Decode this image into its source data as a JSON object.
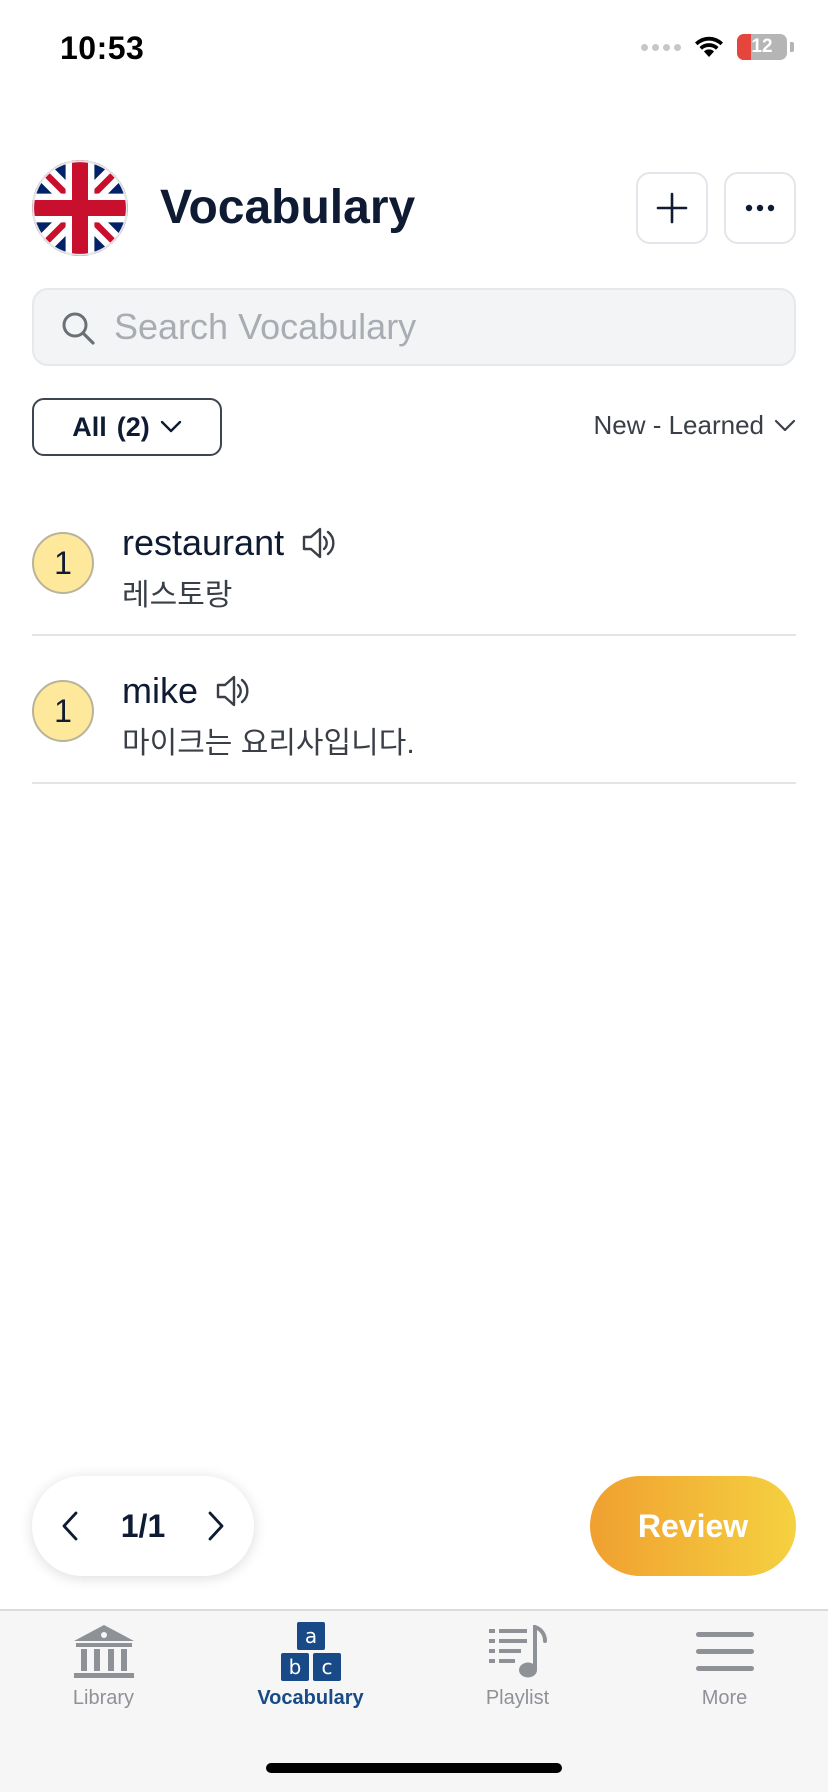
{
  "status_bar": {
    "time": "10:53",
    "battery_text": "12",
    "battery_level": 0.12,
    "battery_color": "#e5453a"
  },
  "header": {
    "title": "Vocabulary",
    "flag_icon": "uk-flag-icon",
    "add_icon": "plus-icon",
    "more_icon": "ellipsis-icon"
  },
  "search": {
    "placeholder": "Search Vocabulary",
    "value": "",
    "icon": "search-icon"
  },
  "filter": {
    "label": "All",
    "count": "(2)"
  },
  "sort": {
    "label": "New - Learned"
  },
  "vocab_items": [
    {
      "level": "1",
      "word": "restaurant",
      "translation": "레스토랑"
    },
    {
      "level": "1",
      "word": "mike",
      "translation": "마이크는 요리사입니다."
    }
  ],
  "pagination": {
    "page": "1/1"
  },
  "review_button": {
    "label": "Review"
  },
  "tabs": [
    {
      "label": "Library",
      "icon": "library-icon"
    },
    {
      "label": "Vocabulary",
      "icon": "abc-blocks-icon",
      "active": true
    },
    {
      "label": "Playlist",
      "icon": "playlist-icon"
    },
    {
      "label": "More",
      "icon": "menu-icon"
    }
  ],
  "colors": {
    "accent": "#174a86",
    "badge_new": "#fde89b",
    "review_start": "#f0a030",
    "review_end": "#f5d140",
    "flag_blue": "#012169",
    "flag_red": "#c8102e"
  }
}
